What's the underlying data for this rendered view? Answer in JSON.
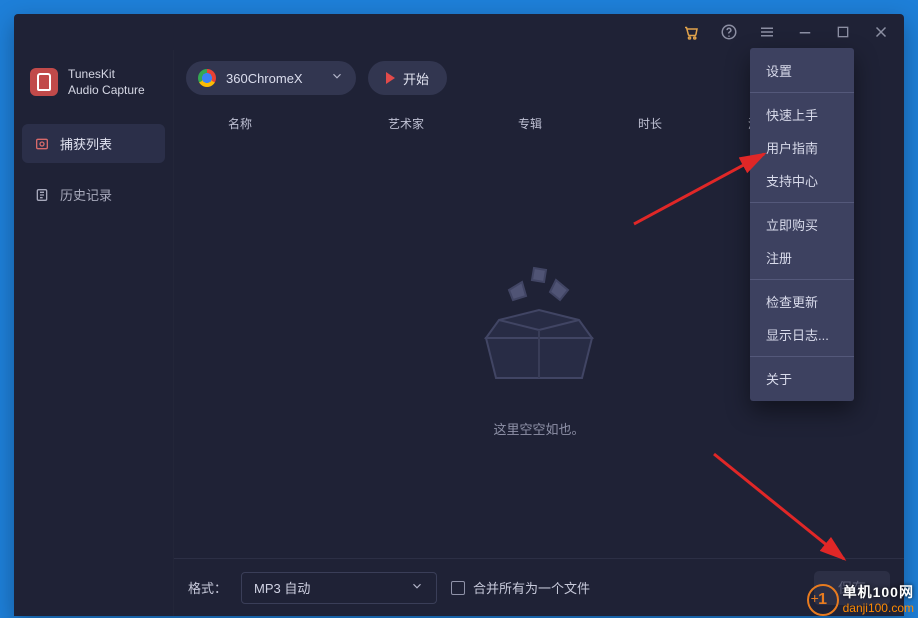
{
  "app": {
    "name_line1": "TunesKit",
    "name_line2": "Audio Capture"
  },
  "sidebar": {
    "items": [
      {
        "label": "捕获列表"
      },
      {
        "label": "历史记录"
      }
    ]
  },
  "top": {
    "source_selected": "360ChromeX",
    "start": "开始"
  },
  "columns": {
    "c1": "名称",
    "c2": "艺术家",
    "c3": "专辑",
    "c4": "时长",
    "c5": "添加日期"
  },
  "empty": {
    "text": "这里空空如也。"
  },
  "bottom": {
    "format_label": "格式：",
    "format_value": "MP3 自动",
    "merge_label": "合并所有为一个文件",
    "save": "保存"
  },
  "menu": {
    "groups": [
      [
        "设置"
      ],
      [
        "快速上手",
        "用户指南",
        "支持中心"
      ],
      [
        "立即购买",
        "注册"
      ],
      [
        "检查更新",
        "显示日志..."
      ],
      [
        "关于"
      ]
    ]
  },
  "watermark": {
    "top": "单机100网",
    "bottom": "danji100.com"
  }
}
